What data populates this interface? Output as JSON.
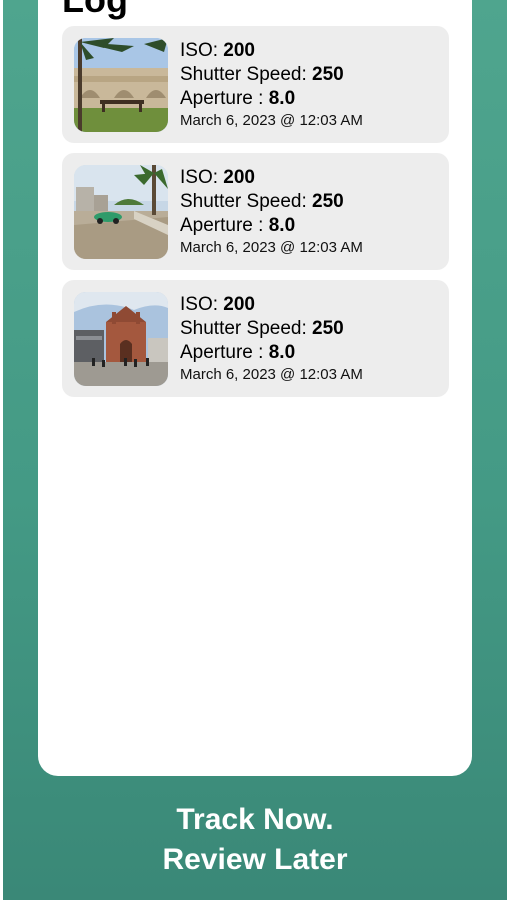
{
  "header": {
    "title": "Log"
  },
  "labels": {
    "iso": "ISO: ",
    "shutter": "Shutter Speed: ",
    "aperture": "Aperture : "
  },
  "entries": [
    {
      "iso": "200",
      "shutter": "250",
      "aperture": "8.0",
      "date": "March 6, 2023 @ 12:03 AM",
      "photo": "bridge-with-palm-and-bench"
    },
    {
      "iso": "200",
      "shutter": "250",
      "aperture": "8.0",
      "date": "March 6, 2023 @ 12:03 AM",
      "photo": "street-with-palm-and-cart"
    },
    {
      "iso": "200",
      "shutter": "250",
      "aperture": "8.0",
      "date": "March 6, 2023 @ 12:03 AM",
      "photo": "brick-market-building"
    }
  ],
  "tagline": {
    "line1": "Track Now.",
    "line2": "Review Later"
  },
  "colors": {
    "background": "#449a85",
    "card": "#ffffff",
    "entry": "#ededed"
  }
}
